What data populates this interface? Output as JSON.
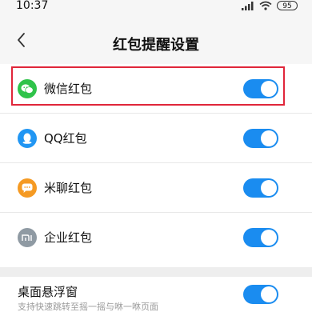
{
  "status_bar": {
    "time": "10:37",
    "battery": "95"
  },
  "header": {
    "title": "红包提醒设置"
  },
  "rows": [
    {
      "label": "微信红包",
      "icon": "wechat-icon",
      "icon_color": "#2fc34a",
      "enabled": true
    },
    {
      "label": "QQ红包",
      "icon": "qq-icon",
      "icon_color": "#2196f3",
      "enabled": true
    },
    {
      "label": "米聊红包",
      "icon": "michat-icon",
      "icon_color": "#f59a23",
      "enabled": true
    },
    {
      "label": "企业红包",
      "icon": "mi-enterprise-icon",
      "icon_color": "#8f9aa3",
      "enabled": true
    }
  ],
  "floating_window": {
    "title": "桌面悬浮窗",
    "subtitle": "支持快速跳转至摇一摇与咻一咻页面",
    "enabled": true
  },
  "colors": {
    "toggle_on": "#1a8cf0",
    "highlight": "#e0263a"
  }
}
